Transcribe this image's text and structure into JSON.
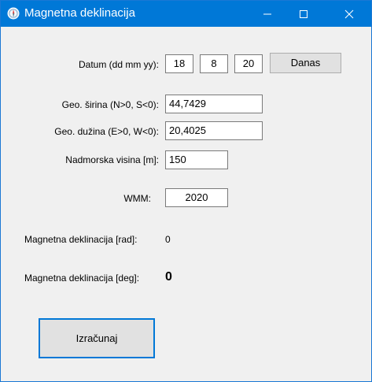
{
  "window": {
    "title": "Magnetna deklinacija"
  },
  "date": {
    "label": "Datum (dd mm yy):",
    "day": "18",
    "month": "8",
    "year": "20",
    "today_button": "Danas"
  },
  "latitude": {
    "label": "Geo. širina (N>0, S<0):",
    "value": "44,7429"
  },
  "longitude": {
    "label": "Geo. dužina (E>0, W<0):",
    "value": "20,4025"
  },
  "altitude": {
    "label": "Nadmorska visina [m]:",
    "value": "150"
  },
  "wmm": {
    "label": "WMM:",
    "value": "2020"
  },
  "declination_rad": {
    "label": "Magnetna deklinacija [rad]:",
    "value": "0"
  },
  "declination_deg": {
    "label": "Magnetna deklinacija [deg]:",
    "value": "0"
  },
  "calculate_button": "Izračunaj",
  "colors": {
    "titlebar": "#0078d7",
    "window_bg": "#f0f0f0",
    "button_bg": "#e1e1e1",
    "focus_border": "#0078d7"
  }
}
